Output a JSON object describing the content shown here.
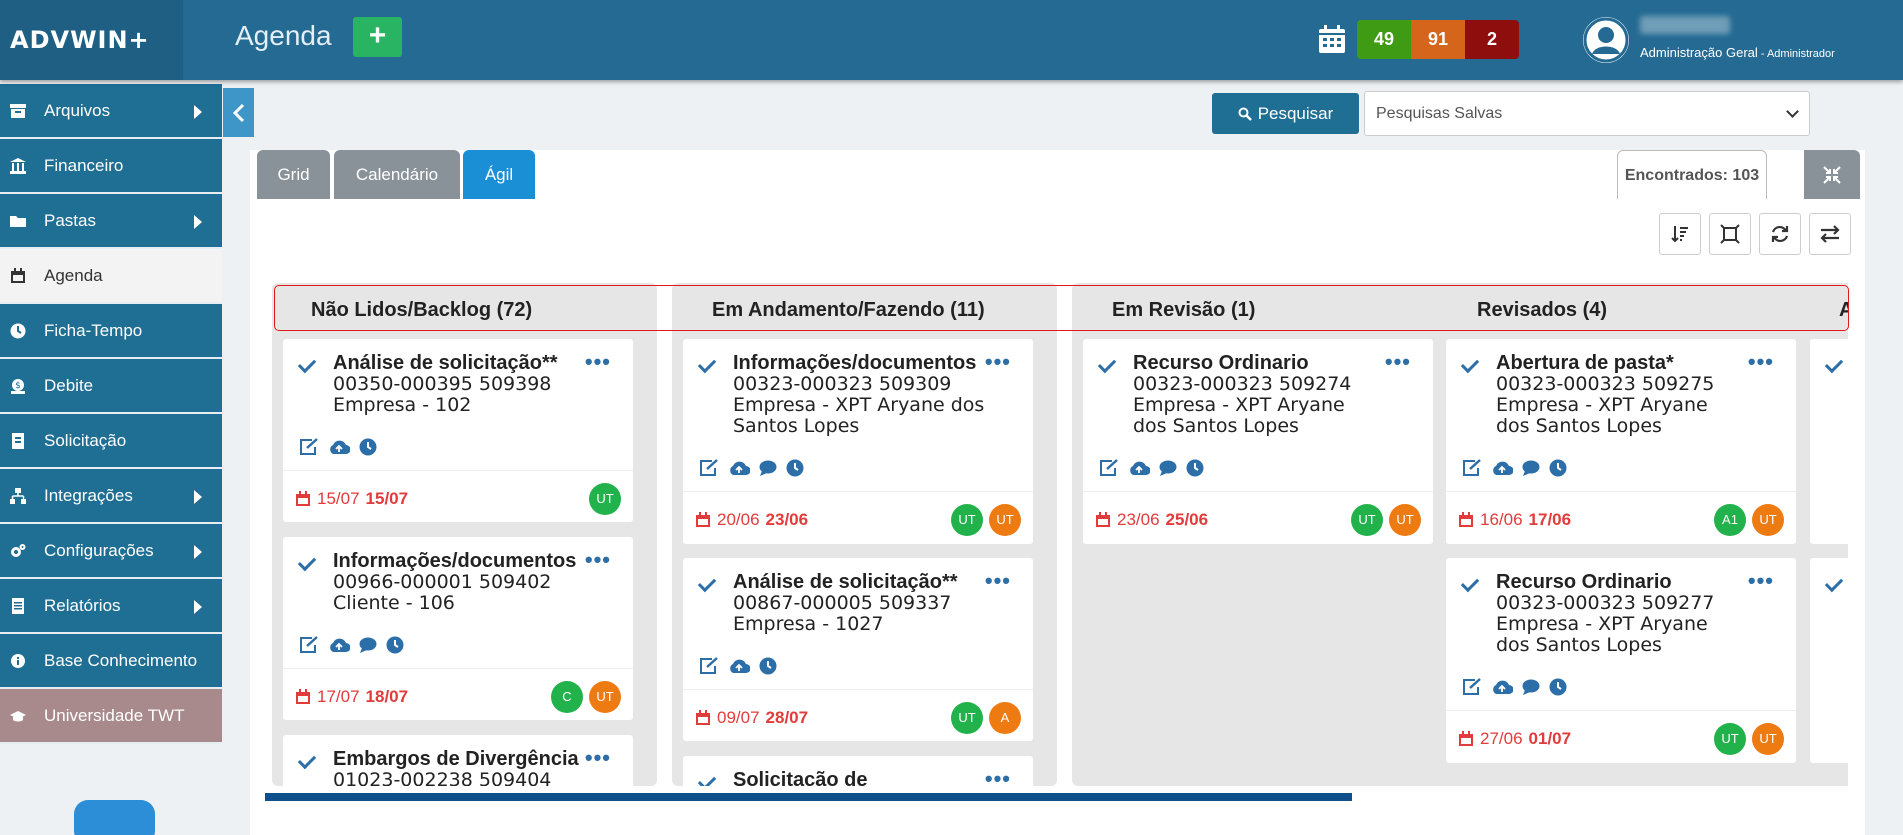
{
  "header": {
    "logo": "ADVWIN+",
    "page_title": "Agenda",
    "add_label": "+",
    "counts": [
      "49",
      "91",
      "2"
    ],
    "user_role": "Administração Geral",
    "user_role_suffix": " - Administrador"
  },
  "sidebar": {
    "items": [
      {
        "label": "Arquivos",
        "icon": "archive-icon"
      },
      {
        "label": "Financeiro",
        "icon": "bank-icon"
      },
      {
        "label": "Pastas",
        "icon": "folder-icon"
      },
      {
        "label": "Agenda",
        "icon": "calendar-icon"
      },
      {
        "label": "Ficha-Tempo",
        "icon": "clock-icon"
      },
      {
        "label": "Debite",
        "icon": "money-icon"
      },
      {
        "label": "Solicitação",
        "icon": "document-icon"
      },
      {
        "label": "Integrações",
        "icon": "network-icon"
      },
      {
        "label": "Configurações",
        "icon": "gears-icon"
      },
      {
        "label": "Relatórios",
        "icon": "report-icon"
      },
      {
        "label": "Base Conhecimento",
        "icon": "info-icon"
      },
      {
        "label": "Universidade TWT",
        "icon": "graduation-cap-icon"
      }
    ]
  },
  "toolbar": {
    "search_label": "Pesquisar",
    "saved_searches": "Pesquisas Salvas",
    "tabs": [
      "Grid",
      "Calendário",
      "Ágil"
    ],
    "found": "Encontrados: 103"
  },
  "columns": [
    {
      "title": "Não Lidos/Backlog (72)",
      "cards": [
        {
          "title": "Análise de solicitação**",
          "body": "00350-000395 509398\nEmpresa - 102",
          "date1": "15/07",
          "date2": "15/07",
          "badges": [
            "UT"
          ]
        },
        {
          "title": "Informações/documentos",
          "body": "00966-000001 509402\nCliente - 106",
          "date1": "17/07",
          "date2": "18/07",
          "badges": [
            "C",
            "UT"
          ]
        },
        {
          "title": "Embargos de Divergência",
          "body": "01023-002238 509404"
        }
      ]
    },
    {
      "title": "Em Andamento/Fazendo (11)",
      "cards": [
        {
          "title": "Informações/documentos",
          "body": "00323-000323 509309\nEmpresa - XPT Aryane dos\nSantos Lopes",
          "date1": "20/06",
          "date2": "23/06",
          "badges": [
            "UT",
            "UT"
          ]
        },
        {
          "title": "Análise de solicitação**",
          "body": "00867-000005 509337\nEmpresa - 1027",
          "date1": "09/07",
          "date2": "28/07",
          "badges": [
            "UT",
            "A"
          ]
        },
        {
          "title": "Solicitação de"
        }
      ]
    },
    {
      "title": "Em Revisão (1)",
      "cards": [
        {
          "title": "Recurso Ordinario",
          "body": "00323-000323 509274\nEmpresa - XPT Aryane\ndos Santos Lopes",
          "date1": "23/06",
          "date2": "25/06",
          "badges": [
            "UT",
            "UT"
          ]
        }
      ]
    },
    {
      "title": "Revisados (4)",
      "cards": [
        {
          "title": "Abertura de pasta*",
          "body": "00323-000323 509275\nEmpresa - XPT Aryane\ndos Santos Lopes",
          "date1": "16/06",
          "date2": "17/06",
          "badges": [
            "A1",
            "UT"
          ]
        },
        {
          "title": "Recurso Ordinario",
          "body": "00323-000323 509277\nEmpresa - XPT Aryane\ndos Santos Lopes",
          "date1": "27/06",
          "date2": "01/07",
          "badges": [
            "UT",
            "UT"
          ]
        }
      ]
    },
    {
      "title": "A"
    }
  ]
}
